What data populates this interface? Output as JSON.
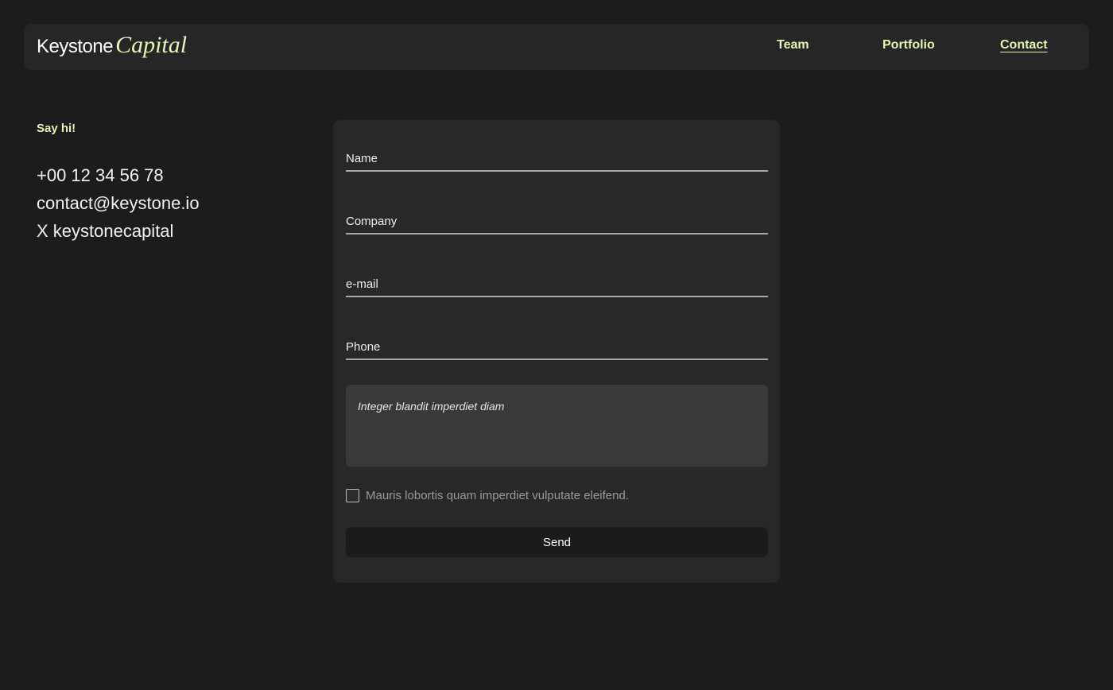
{
  "header": {
    "logo": {
      "main": "Keystone",
      "accent": "Capital"
    },
    "nav": [
      {
        "label": "Team"
      },
      {
        "label": "Portfolio"
      },
      {
        "label": "Contact",
        "active": true
      }
    ]
  },
  "contact": {
    "greeting": "Say hi!",
    "phone": "+00 12 34 56 78",
    "email": "contact@keystone.io",
    "social": "X keystonecapital"
  },
  "form": {
    "name_placeholder": "Name",
    "company_placeholder": "Company",
    "email_placeholder": "e-mail",
    "phone_placeholder": "Phone",
    "message_placeholder": "Integer blandit imperdiet diam",
    "consent_label": "Mauris lobortis quam imperdiet vulputate eleifend.",
    "consent_checked": false,
    "send_label": "Send"
  },
  "colors": {
    "background": "#1c1c1c",
    "surface": "#262626",
    "accent": "#e2f6b6",
    "field_bg": "#393939",
    "button_bg": "#1b1b1b"
  }
}
